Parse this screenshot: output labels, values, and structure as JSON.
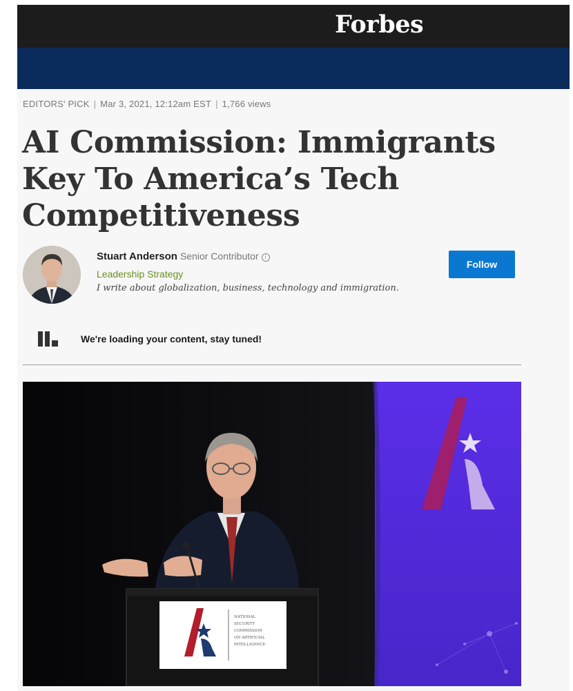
{
  "brand": {
    "logo_text": "Forbes",
    "topbar_color": "#1c1c1c",
    "nav_color": "#0b2b5c"
  },
  "article": {
    "category": "EDITORS' PICK",
    "date": "Mar 3, 2021, 12:12am EST",
    "views": "1,766 views",
    "headline": "AI Commission: Immigrants Key To America’s Tech Competitiveness"
  },
  "author": {
    "name": "Stuart Anderson",
    "role": "Senior Contributor",
    "channel": "Leadership Strategy",
    "bio": "I write about globalization, business, technology and immigration.",
    "follow_label": "Follow",
    "accent_color": "#0a78d1"
  },
  "loading": {
    "text": "We're loading your content, stay tuned!"
  },
  "hero": {
    "podium_lines": [
      "NATIONAL",
      "SECURITY",
      "COMMISSION",
      "ON ARTIFICIAL",
      "INTELLIGENCE"
    ]
  }
}
